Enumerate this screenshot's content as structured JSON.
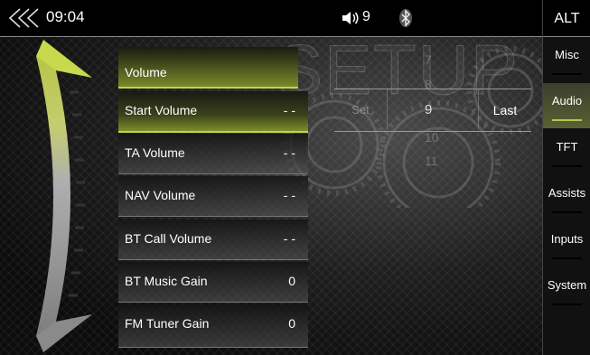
{
  "topbar": {
    "clock": "09:04",
    "volume_level": "9",
    "icons": [
      "back-double-chevron-icon",
      "speaker-icon",
      "bluetooth-icon"
    ]
  },
  "right_panel": {
    "alt_label": "ALT",
    "tabs": [
      {
        "label": "Misc",
        "active": false
      },
      {
        "label": "Audio",
        "active": true
      },
      {
        "label": "TFT",
        "active": false
      },
      {
        "label": "Assists",
        "active": false
      },
      {
        "label": "Inputs",
        "active": false
      },
      {
        "label": "System",
        "active": false
      }
    ]
  },
  "watermark": "SETUP",
  "settings": [
    {
      "label": "Volume",
      "value": ""
    },
    {
      "label": "Start Volume",
      "value": "- -"
    },
    {
      "label": "TA Volume",
      "value": "- -"
    },
    {
      "label": "NAV Volume",
      "value": "- -"
    },
    {
      "label": "BT Call Volume",
      "value": "- -"
    },
    {
      "label": "BT Music Gain",
      "value": "0"
    },
    {
      "label": "FM Tuner Gain",
      "value": "0"
    }
  ],
  "picker": {
    "values": [
      "7",
      "8",
      "9",
      "10",
      "11"
    ],
    "selected": "9",
    "set_label": "Set",
    "last_label": "Last"
  },
  "colors": {
    "accent": "#c3d44b",
    "background": "#0b0b0b"
  }
}
